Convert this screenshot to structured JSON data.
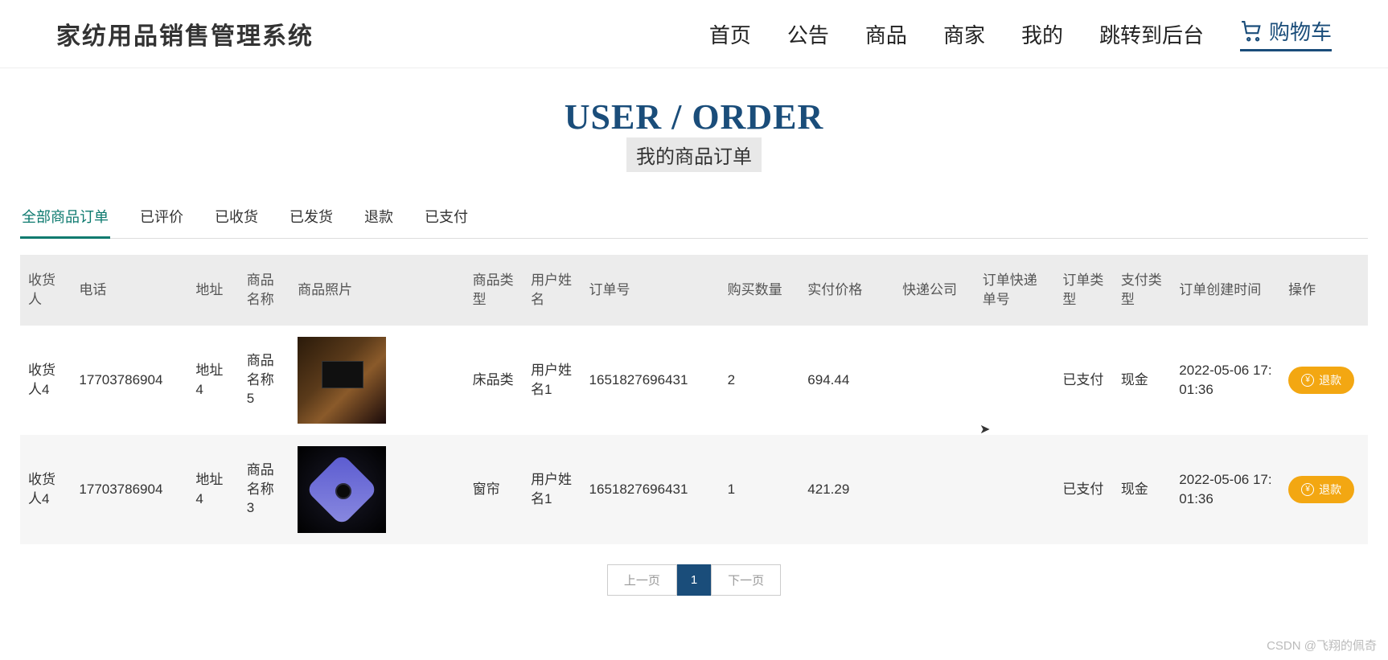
{
  "header": {
    "site_title": "家纺用品销售管理系统",
    "nav": [
      "首页",
      "公告",
      "商品",
      "商家",
      "我的",
      "跳转到后台"
    ],
    "cart_label": "购物车"
  },
  "page": {
    "heading_en": "USER / ORDER",
    "heading_cn": "我的商品订单"
  },
  "tabs": [
    "全部商品订单",
    "已评价",
    "已收货",
    "已发货",
    "退款",
    "已支付"
  ],
  "active_tab": 0,
  "columns": [
    "收货人",
    "电话",
    "地址",
    "商品名称",
    "商品照片",
    "商品类型",
    "用户姓名",
    "订单号",
    "购买数量",
    "实付价格",
    "快递公司",
    "订单快递单号",
    "订单类型",
    "支付类型",
    "订单创建时间",
    "操作"
  ],
  "rows": [
    {
      "receiver": "收货人4",
      "phone": "17703786904",
      "address": "地址4",
      "prod_name": "商品名称5",
      "prod_type": "床品类",
      "user_name": "用户姓名1",
      "order_no": "1651827696431",
      "qty": "2",
      "price": "694.44",
      "courier": "",
      "tracking": "",
      "order_type": "已支付",
      "pay_type": "现金",
      "created": "2022-05-06 17:01:36",
      "op_label": "退款"
    },
    {
      "receiver": "收货人4",
      "phone": "17703786904",
      "address": "地址4",
      "prod_name": "商品名称3",
      "prod_type": "窗帘",
      "user_name": "用户姓名1",
      "order_no": "1651827696431",
      "qty": "1",
      "price": "421.29",
      "courier": "",
      "tracking": "",
      "order_type": "已支付",
      "pay_type": "现金",
      "created": "2022-05-06 17:01:36",
      "op_label": "退款"
    }
  ],
  "pagination": {
    "prev": "上一页",
    "current": "1",
    "next": "下一页"
  },
  "watermark": "CSDN @飞翔的佩奇"
}
